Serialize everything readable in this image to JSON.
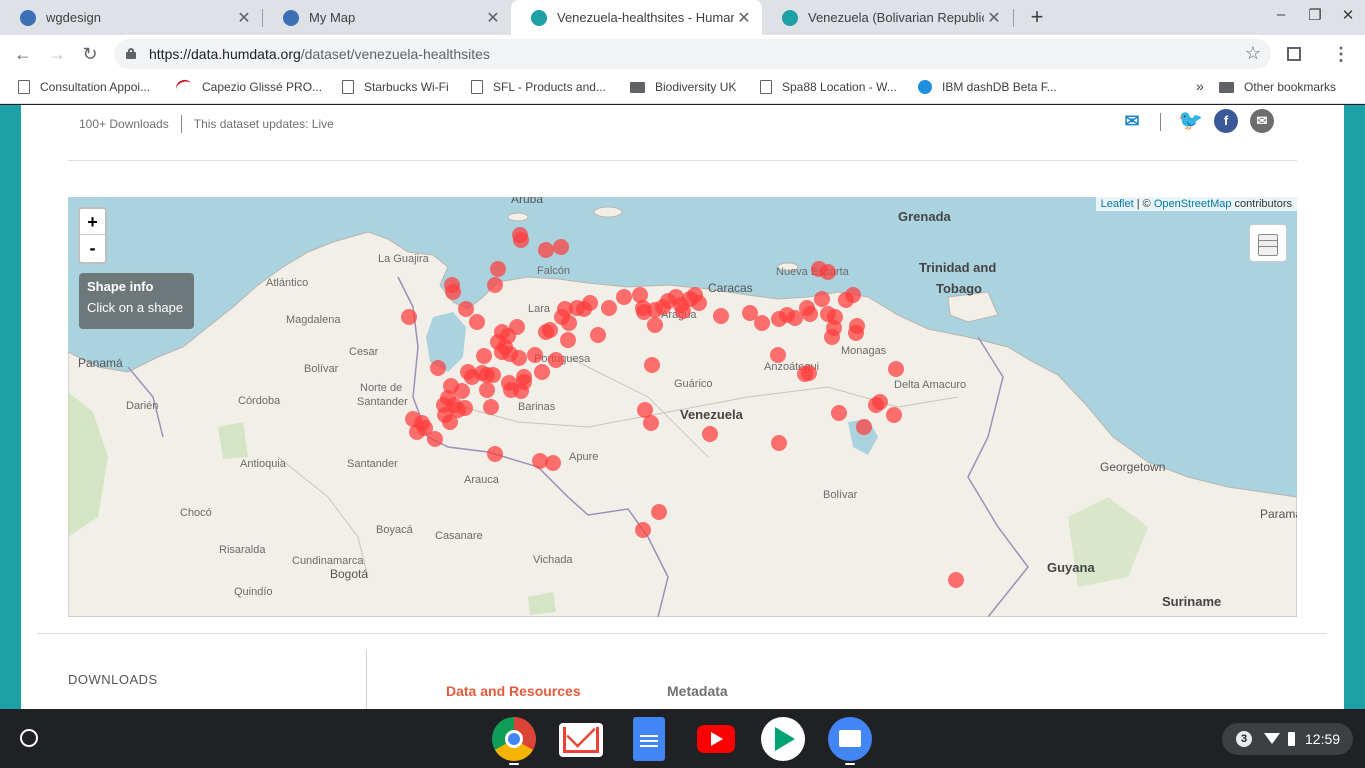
{
  "tabs": [
    {
      "title": "wgdesign",
      "favicon_color": "#3b6fb6",
      "active": false
    },
    {
      "title": "My Map",
      "favicon_color": "#3b6fb6",
      "active": false
    },
    {
      "title": "Venezuela-healthsites - Humanit",
      "favicon_color": "#1ea0a7",
      "active": true
    },
    {
      "title": "Venezuela (Bolivarian Republic o",
      "favicon_color": "#1ea0a7",
      "active": false
    }
  ],
  "window_controls": {
    "minimize": "–",
    "restore": "❐",
    "close": "✕"
  },
  "toolbar": {
    "url_host": "https://data.humdata.org",
    "url_path": "/dataset/venezuela-healthsites",
    "back": "←",
    "forward": "→",
    "reload": "↻",
    "star": "☆",
    "menu": "⋮"
  },
  "bookmarks": [
    {
      "label": "Consultation Appoi...",
      "icon": "page-icon"
    },
    {
      "label": "Capezio Glissé PRO...",
      "icon": "capezio-icon"
    },
    {
      "label": "Starbucks Wi-Fi",
      "icon": "page-icon"
    },
    {
      "label": "SFL - Products and...",
      "icon": "page-icon"
    },
    {
      "label": "Biodiversity UK",
      "icon": "folder-icon"
    },
    {
      "label": "Spa88 Location - W...",
      "icon": "page-icon"
    },
    {
      "label": "IBM dashDB Beta F...",
      "icon": "ibm-icon"
    }
  ],
  "bookmarks_overflow": "»",
  "other_bookmarks": "Other bookmarks",
  "dataset": {
    "downloads": "100+ Downloads",
    "updates": "This dataset updates: Live"
  },
  "map": {
    "zoom_in": "+",
    "zoom_out": "-",
    "info_title": "Shape info",
    "info_subtitle": "Click on a shape",
    "attribution_leaflet": "Leaflet",
    "attribution_sep": " | © ",
    "attribution_osm": "OpenStreetMap",
    "attribution_suffix": " contributors",
    "labels": [
      {
        "text": "Aruba",
        "style": "mid"
      },
      {
        "text": "Grenada",
        "style": "big"
      },
      {
        "text": "Trinidad and",
        "style": "big"
      },
      {
        "text": "Tobago",
        "style": "big"
      },
      {
        "text": "La Guajira",
        "style": "small"
      },
      {
        "text": "Falcón",
        "style": "small"
      },
      {
        "text": "Atlántico",
        "style": "small"
      },
      {
        "text": "Caracas",
        "style": "mid"
      },
      {
        "text": "Nueva Esparta",
        "style": "small"
      },
      {
        "text": "Magdalena",
        "style": "small"
      },
      {
        "text": "Lara",
        "style": "small"
      },
      {
        "text": "Aragua",
        "style": "small"
      },
      {
        "text": "Panamá",
        "style": "mid"
      },
      {
        "text": "Cesar",
        "style": "small"
      },
      {
        "text": "Bolívar",
        "style": "small"
      },
      {
        "text": "Portuguesa",
        "style": "small"
      },
      {
        "text": "Monagas",
        "style": "small"
      },
      {
        "text": "Norte de",
        "style": "small"
      },
      {
        "text": "Santander",
        "style": "small"
      },
      {
        "text": "Anzoátegui",
        "style": "small"
      },
      {
        "text": "Delta Amacuro",
        "style": "small"
      },
      {
        "text": "Guárico",
        "style": "small"
      },
      {
        "text": "Darién",
        "style": "small"
      },
      {
        "text": "Córdoba",
        "style": "small"
      },
      {
        "text": "Barinas",
        "style": "small"
      },
      {
        "text": "Venezuela",
        "style": "big"
      },
      {
        "text": "Antioquia",
        "style": "small"
      },
      {
        "text": "Santander",
        "style": "small"
      },
      {
        "text": "Apure",
        "style": "small"
      },
      {
        "text": "Georgetown",
        "style": "mid"
      },
      {
        "text": "Arauca",
        "style": "small"
      },
      {
        "text": "Bolívar",
        "style": "small"
      },
      {
        "text": "Chocó",
        "style": "small"
      },
      {
        "text": "Boyacá",
        "style": "small"
      },
      {
        "text": "Casanare",
        "style": "small"
      },
      {
        "text": "Paramari",
        "style": "mid"
      },
      {
        "text": "Risaralda",
        "style": "small"
      },
      {
        "text": "Cundinamarca",
        "style": "small"
      },
      {
        "text": "Bogotá",
        "style": "mid"
      },
      {
        "text": "Vichada",
        "style": "small"
      },
      {
        "text": "Guyana",
        "style": "big"
      },
      {
        "text": "Quindío",
        "style": "small"
      },
      {
        "text": "Suriname",
        "style": "big"
      }
    ],
    "marker_color": "#ff3b3b"
  },
  "downloads_section": "DOWNLOADS",
  "page_tabs": [
    {
      "label": "Data and Resources",
      "color": "#e35b3c"
    },
    {
      "label": "Metadata",
      "color": "#707070"
    }
  ],
  "shelf": {
    "apps": [
      "chrome-icon",
      "gmail-icon",
      "docs-icon",
      "youtube-icon",
      "play-store-icon",
      "files-icon"
    ],
    "notification_count": "3",
    "time": "12:59"
  }
}
